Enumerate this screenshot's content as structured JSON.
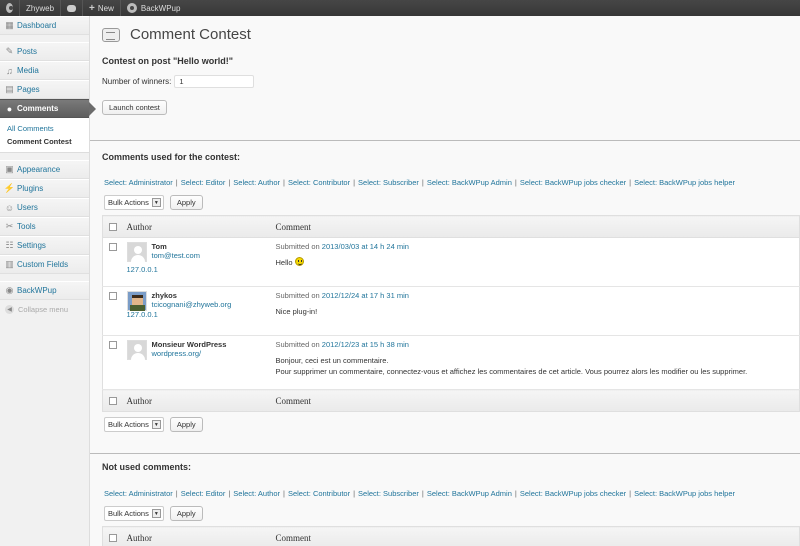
{
  "adminbar": {
    "site_name": "Zhyweb",
    "new_label": "New",
    "plugin_label": "BackWPup"
  },
  "menu": {
    "dashboard": "Dashboard",
    "posts": "Posts",
    "media": "Media",
    "pages": "Pages",
    "comments": "Comments",
    "sub_all_comments": "All Comments",
    "sub_comment_contest": "Comment Contest",
    "appearance": "Appearance",
    "plugins": "Plugins",
    "users": "Users",
    "tools": "Tools",
    "settings": "Settings",
    "custom_fields": "Custom Fields",
    "backwpup": "BackWPup",
    "collapse": "Collapse menu"
  },
  "page": {
    "title": "Comment Contest",
    "contest_heading": "Contest on post \"Hello world!\"",
    "winners_label": "Number of winners:",
    "winners_value": "1",
    "launch_button": "Launch contest",
    "used_heading": "Comments used for the contest:",
    "not_used_heading": "Not used comments:"
  },
  "filters": [
    "Select: Administrator",
    "Select: Editor",
    "Select: Author",
    "Select: Contributor",
    "Select: Subscriber",
    "Select: BackWPup Admin",
    "Select: BackWPup jobs checker",
    "Select: BackWPup jobs helper"
  ],
  "bulk": {
    "label": "Bulk Actions",
    "apply": "Apply"
  },
  "table": {
    "col_author": "Author",
    "col_comment": "Comment",
    "submitted_prefix": "Submitted on",
    "rows": [
      {
        "name": "Tom",
        "email": "tom@test.com",
        "ip": "127.0.0.1",
        "date": "2013/03/03 at 14 h 24 min",
        "text1": "Hello",
        "text2": ""
      },
      {
        "name": "zhykos",
        "email": "tcicognani@zhyweb.org",
        "ip": "127.0.0.1",
        "date": "2012/12/24 at 17 h 31 min",
        "text1": "Nice plug-in!",
        "text2": ""
      },
      {
        "name": "Monsieur WordPress",
        "email": "wordpress.org/",
        "ip": "",
        "date": "2012/12/23 at 15 h 38 min",
        "text1": "Bonjour, ceci est un commentaire.",
        "text2": "Pour supprimer un commentaire, connectez-vous et affichez les commentaires de cet article. Vous pourrez alors les modifier ou les supprimer."
      }
    ]
  }
}
